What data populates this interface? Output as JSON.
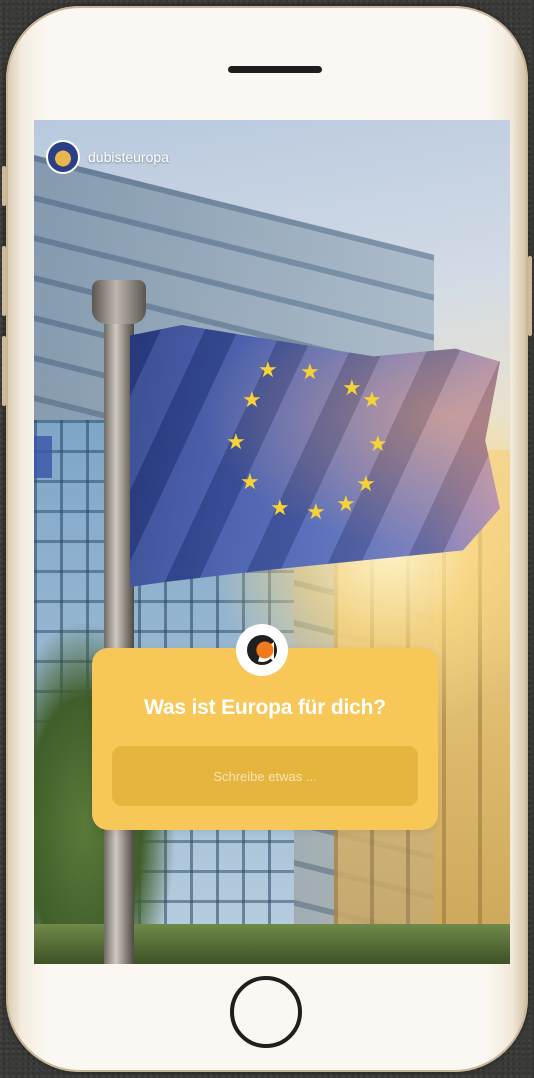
{
  "story": {
    "username": "dubisteuropa",
    "question": "Was ist Europa für dich?",
    "input_placeholder": "Schreibe etwas ..."
  },
  "colors": {
    "card": "#f7c758",
    "accent": "#f07a1c",
    "flag_blue": "#3e56a8",
    "star": "#f6d236"
  },
  "icons": {
    "avatar": "eu-flag-avatar",
    "question_logo": "dubisteuropa-logo-icon",
    "home": "home-button"
  }
}
